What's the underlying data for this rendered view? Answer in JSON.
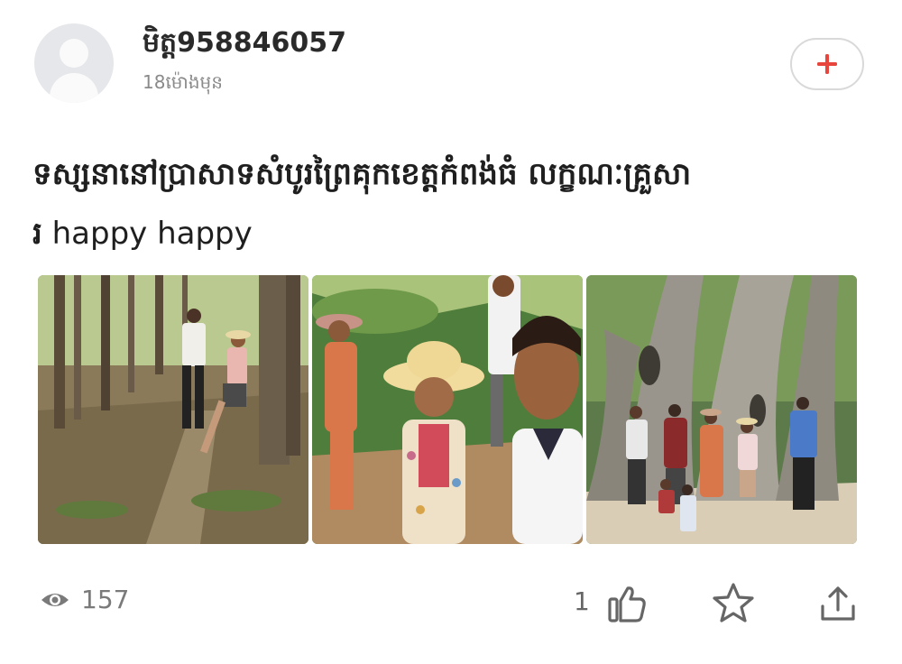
{
  "post": {
    "username": "មិត្ត958846057",
    "time": "18ម៉ោងមុន",
    "title_km": "ទស្សនានៅប្រាសាទសំបូរព្រៃគុកខេត្តកំពង់ធំ លក្ខណៈគ្រួសា",
    "title_line2_km": "រ",
    "title_en": " happy happy",
    "views": "157",
    "likes": "1"
  },
  "photos": [
    {
      "scene": "forest-path-couple"
    },
    {
      "scene": "group-selfie-ruins"
    },
    {
      "scene": "family-at-banyan-tree"
    }
  ],
  "icons": {
    "follow": "plus-icon",
    "views": "eye-icon",
    "like": "thumbs-up-icon",
    "favorite": "star-icon",
    "share": "share-icon"
  },
  "colors": {
    "accent": "#e8453c",
    "icon_gray": "#7a7a7a"
  }
}
